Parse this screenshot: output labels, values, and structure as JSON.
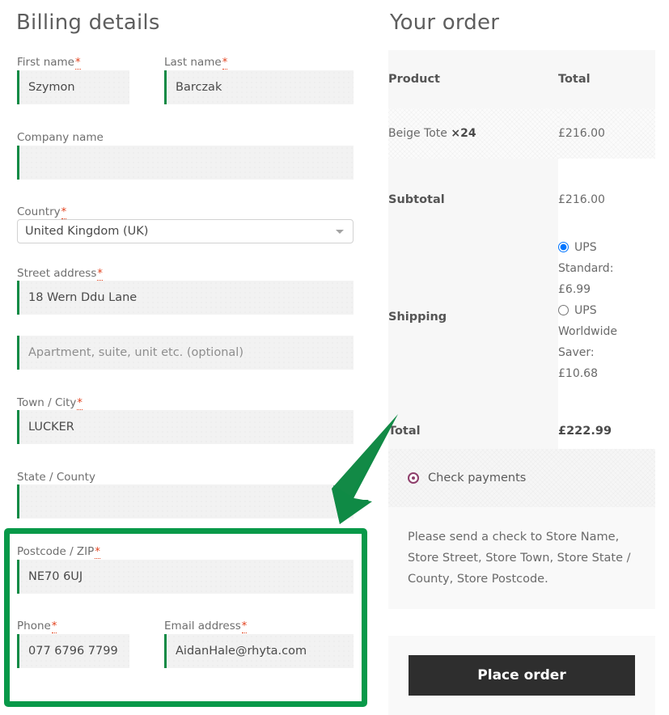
{
  "billing": {
    "title": "Billing details",
    "required_marker": "*",
    "fields": [
      {
        "label": "First name",
        "required": true,
        "value": "Szymon",
        "placeholder": ""
      },
      {
        "label": "Last name",
        "required": true,
        "value": "Barczak",
        "placeholder": ""
      },
      {
        "label": "Company name",
        "required": false,
        "value": "",
        "placeholder": ""
      },
      {
        "label": "Country",
        "required": true,
        "value": "United Kingdom (UK)",
        "placeholder": ""
      },
      {
        "label": "Street address",
        "required": true,
        "value": "18 Wern Ddu Lane",
        "placeholder": ""
      },
      {
        "label": "",
        "required": false,
        "value": "",
        "placeholder": "Apartment, suite, unit etc. (optional)"
      },
      {
        "label": "Town / City",
        "required": true,
        "value": "LUCKER",
        "placeholder": ""
      },
      {
        "label": "State / County",
        "required": false,
        "value": "",
        "placeholder": ""
      },
      {
        "label": "Postcode / ZIP",
        "required": true,
        "value": "NE70 6UJ",
        "placeholder": ""
      },
      {
        "label": "Phone",
        "required": true,
        "value": "077 6796 7799",
        "placeholder": ""
      },
      {
        "label": "Email address",
        "required": true,
        "value": "AidanHale@rhyta.com",
        "placeholder": ""
      }
    ],
    "country_options": [
      "United Kingdom (UK)"
    ]
  },
  "order": {
    "title": "Your order",
    "columns": {
      "product": "Product",
      "total": "Total"
    },
    "items": [
      {
        "name": "Beige Tote",
        "times": "×",
        "qty": "24",
        "total": "£216.00"
      }
    ],
    "subtotal_label": "Subtotal",
    "subtotal_value": "£216.00",
    "shipping_label": "Shipping",
    "shipping_options": [
      {
        "label": "UPS Standard: £6.99",
        "selected": true
      },
      {
        "label": "UPS Worldwide Saver: £10.68",
        "selected": false
      }
    ],
    "total_label": "Total",
    "total_value": "£222.99"
  },
  "payment": {
    "method_label": "Check payments",
    "method_selected": true,
    "description": "Please send a check to Store Name, Store Street, Store Town, Store State / County, Store Postcode.",
    "place_order_label": "Place order",
    "radio_color": "#8e3e6b"
  },
  "annotation": {
    "highlight_color": "#089949",
    "arrow_color": "#0f8a45",
    "shape": "rounded-rectangle-and-arrow"
  },
  "colors": {
    "input_accent": "#0f8a45",
    "required_star": "#e2401c",
    "button_bg": "#2e2e2e",
    "panel_bg": "#f7f7f7"
  }
}
